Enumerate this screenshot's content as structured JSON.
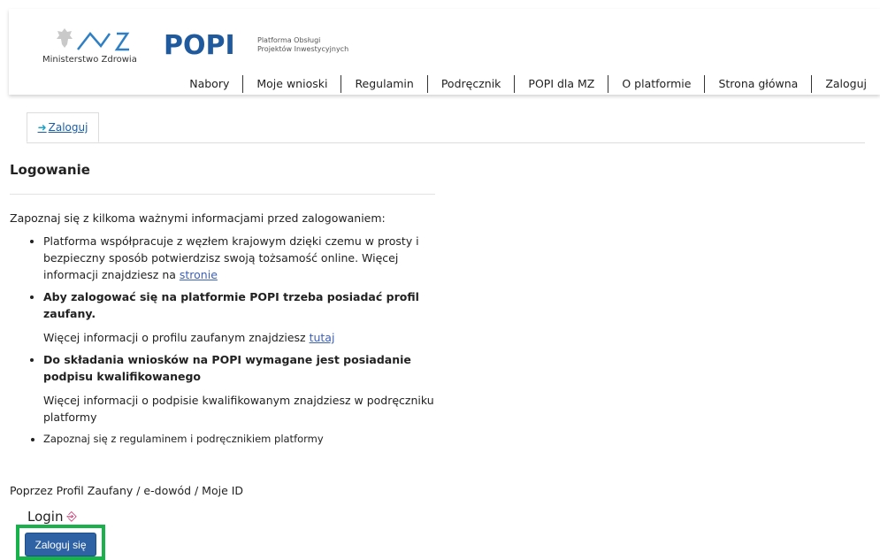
{
  "header": {
    "ministry_caption": "Ministerstwo Zdrowia",
    "popi_logo": "POPI",
    "popi_sub_line1": "Platforma Obsługi",
    "popi_sub_line2": "Projektów Inwestycyjnych",
    "nav": [
      "Nabory",
      "Moje wnioski",
      "Regulamin",
      "Podręcznik",
      "POPI dla MZ",
      "O platformie",
      "Strona główna",
      "Zaloguj"
    ]
  },
  "tabs": {
    "active_label": "Zaloguj",
    "icon": "login-arrow-icon"
  },
  "main": {
    "title": "Logowanie",
    "intro": "Zapoznaj się z kilkoma ważnymi informacjami przed zalogowaniem:",
    "item1_text": "Platforma współpracuje z węzłem krajowym dzięki czemu w prosty i bezpieczny sposób potwierdzisz swoją tożsamość online. Więcej informacji znajdziesz na ",
    "item1_link": "stronie",
    "item2_bold": "Aby zalogować się na platformie POPI trzeba posiadać profil zaufany.",
    "item2_sub": "Więcej informacji o profilu zaufanym znajdziesz ",
    "item2_link": "tutaj",
    "item3_bold": "Do składania wniosków na POPI wymagane jest posiadanie podpisu kwalifikowanego",
    "item3_sub": "Więcej informacji o podpisie kwalifikowanym znajdziesz w podręczniku platformy",
    "item4": "Zapoznaj się z regulaminem i podręcznikiem platformy",
    "method": "Poprzez Profil Zaufany / e-dowód / Moje ID",
    "login_label": "Login",
    "login_button": "Zaloguj się"
  },
  "colors": {
    "brand_blue": "#1f5a9f",
    "button_blue": "#2e62a5",
    "highlight_green": "#19b14c",
    "link": "#3d5fb8"
  }
}
